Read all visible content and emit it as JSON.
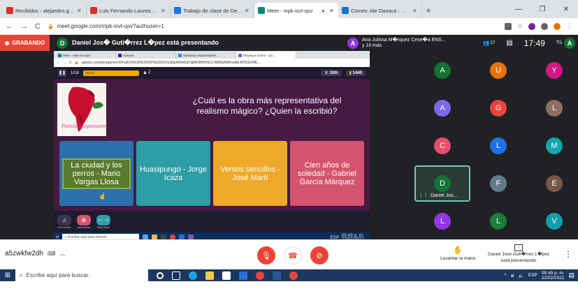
{
  "browser": {
    "tabs": [
      {
        "label": "Recibidos - alejandro.garcia.seg@...",
        "color": "#d93025"
      },
      {
        "label": "Luis Fernando Laurean Barajas (E...",
        "color": "#d93025"
      },
      {
        "label": "Trabajo de clase de Desarrollo c...",
        "color": "#1a73e8"
      },
      {
        "label": "Meet - mpk-isvt-qsv",
        "color": "#00897b"
      },
      {
        "label": "Correo: Ale Oaxaca - Outlook",
        "color": "#0078d4"
      }
    ],
    "url": "meet.google.com/mpk-isvt-qsv?authuser=1"
  },
  "meet": {
    "recording_label": "GRABANDO",
    "presenter_initial": "D",
    "presenter_text": "Daniel Jos� Guti�rrez L�pez está presentando",
    "other_initial": "A",
    "other_name": "Ana Julissa M�rquez Cese�a ENS...",
    "other_more": "y 10 más",
    "people_count": "27",
    "time": "17:49",
    "self_label": "Tú",
    "self_initial": "A",
    "meeting_code": "a5zwkfw2dh",
    "raise_hand": "Levantar la mano",
    "presenting_name": "Daniel José Guti�rrez L�pez",
    "presenting_status": "está presentando"
  },
  "inner": {
    "tabs": [
      {
        "label": "Meet - mpk-isvt-qsv",
        "color": "#00897b"
      },
      {
        "label": "Kahoot!",
        "color": "#46178f"
      },
      {
        "label": "Narrativa Hispanoameri...",
        "color": "#1e88e5"
      },
      {
        "label": "Playing a Game - Qu...",
        "color": "#8854c0"
      }
    ],
    "url": "quizizz.com/join/game/U2FsdGVkX18%2525FNcD0OOuQbpWnkWgTlgWrl0WWSCL4686EA9Mvs0bLRO5SnWE...",
    "counter": "1/18",
    "streak_label": "Streak",
    "players": "2",
    "rank": "10th",
    "score": "1440",
    "image_caption": "Poesía hispanoamericana",
    "question": "¿Cuál es la obra más representativa del realismo mágico? ¿Quien la escribió?",
    "answers": [
      "La ciudad y los perros - Mario Vargas Llosa",
      "Huasipungo - Jorge Icaza",
      "Versos sencillos - José Martí",
      "Cien años de soledad - Gabriel García Márquez"
    ],
    "powerups": [
      "Con música",
      "Auto-lectura",
      "Read Aloud"
    ],
    "taskbar_search": "Escribe aquí para buscar",
    "taskbar_lang": "ESP",
    "taskbar_time": "05:49 p. m.",
    "taskbar_date": "22/02/2021"
  },
  "participants": [
    {
      "initial": "A",
      "color": "#137333"
    },
    {
      "initial": "U",
      "color": "#e8710a"
    },
    {
      "initial": "Y",
      "color": "#d01884"
    },
    {
      "initial": "A",
      "color": "#7b68ee"
    },
    {
      "initial": "G",
      "color": "#e8453c"
    },
    {
      "initial": "L",
      "color": "#8d6e63"
    },
    {
      "initial": "C",
      "color": "#ea4c6d"
    },
    {
      "initial": "L",
      "color": "#1a73e8"
    },
    {
      "initial": "M",
      "color": "#12a4af"
    },
    {
      "initial": "D",
      "color": "#137333",
      "name": "Daniel Jos..."
    },
    {
      "initial": "F",
      "color": "#607d8b"
    },
    {
      "initial": "E",
      "color": "#795548"
    },
    {
      "initial": "L",
      "color": "#9334e6"
    },
    {
      "initial": "L",
      "color": "#188038"
    },
    {
      "initial": "V",
      "color": "#129eaf"
    }
  ],
  "taskbar": {
    "search_placeholder": "Escribe aquí para buscar.",
    "lang": "ESP",
    "time": "05:49 p. m.",
    "date": "22/02/2021"
  }
}
